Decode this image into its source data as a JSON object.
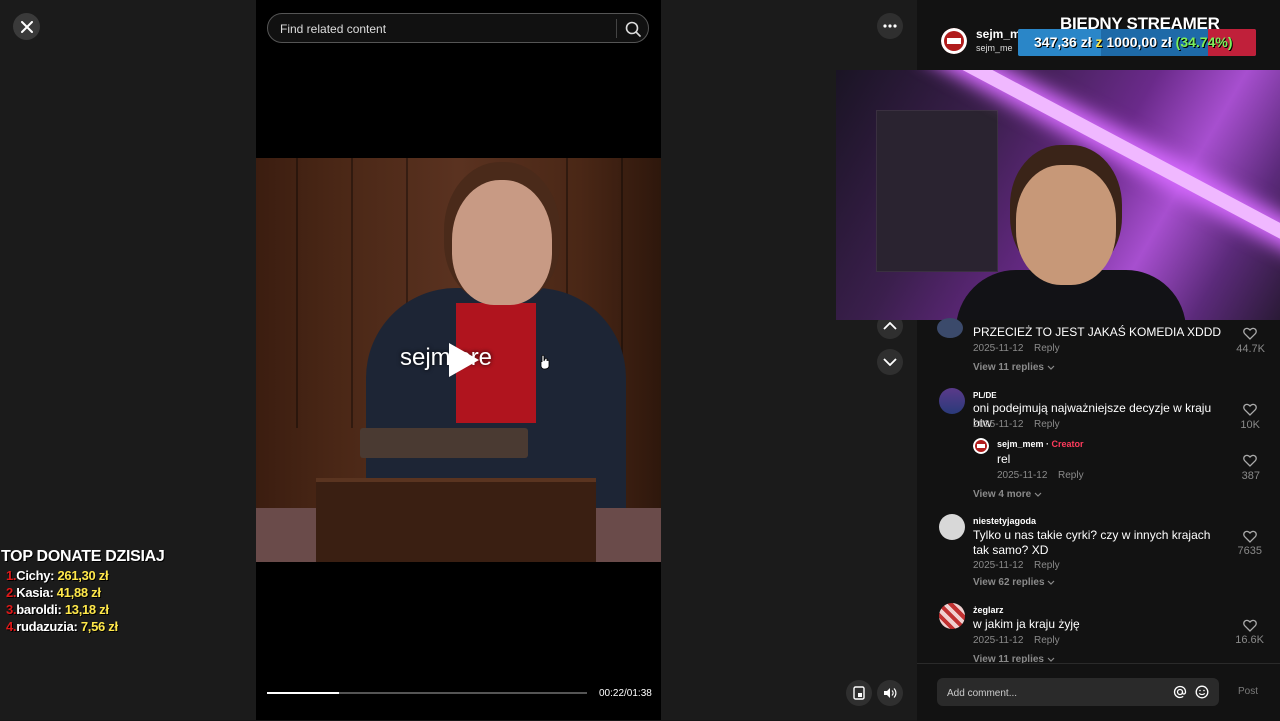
{
  "search": {
    "placeholder": "Find related content"
  },
  "video": {
    "caption": "sejm ore",
    "time": "00:22/01:38",
    "progress": 0.225
  },
  "overlay": {
    "title": "BIEDNY STREAMER",
    "progress_text_current": "347,36 zł",
    "progress_text_mid": "z",
    "progress_text_goal": "1000,00 zł",
    "progress_text_pct": "(34.74%)",
    "progress": 0.3474
  },
  "profile": {
    "username": "sejm_m",
    "handle": "sejm_me"
  },
  "donations": {
    "title": "TOP DONATE DZISIAJ",
    "items": [
      {
        "rank": "1.",
        "name": "Cichy:",
        "amount": "261,30 zł"
      },
      {
        "rank": "2.",
        "name": "Kasia:",
        "amount": "41,88 zł"
      },
      {
        "rank": "3.",
        "name": "baroldi:",
        "amount": "13,18 zł"
      },
      {
        "rank": "4.",
        "name": "rudazuzia:",
        "amount": "7,56 zł"
      }
    ]
  },
  "comments": [
    {
      "user": "",
      "text": "PRZECIEŻ TO JEST JAKAŚ KOMEDIA XDDD",
      "date": "2025-11-12",
      "reply": "Reply",
      "views": "View 11 replies",
      "likes": "44.7K"
    },
    {
      "user": "PL/DE",
      "text": "oni podejmują najważniejsze decyzje w kraju btw",
      "date": "2025-11-12",
      "reply": "Reply",
      "likes": "10K",
      "sub": {
        "user": "sejm_mem",
        "creator": "Creator",
        "text": "rel",
        "date": "2025-11-12",
        "reply": "Reply",
        "likes": "387"
      },
      "views": "View 4 more"
    },
    {
      "user": "niestetyjagoda",
      "text": "Tylko u nas takie cyrki? czy w innych krajach tak samo? XD",
      "date": "2025-11-12",
      "reply": "Reply",
      "views": "View 62 replies",
      "likes": "7635"
    },
    {
      "user": "żeglarz",
      "text": "w jakim ja kraju żyję",
      "date": "2025-11-12",
      "reply": "Reply",
      "views": "View 11 replies",
      "likes": "16.6K"
    }
  ],
  "composer": {
    "placeholder": "Add comment...",
    "post": "Post"
  },
  "colors": {
    "accent": "#ff3b5c",
    "donate_rank": "#e01818",
    "donate_amount": "#ffe84a",
    "bar_blue": "#1e6aa8"
  },
  "icons": [
    "close-icon",
    "search-icon",
    "play-icon",
    "more-icon",
    "chevron-up-icon",
    "chevron-down-icon",
    "floating-player-icon",
    "volume-icon",
    "heart-icon",
    "mention-icon",
    "emoji-icon"
  ]
}
